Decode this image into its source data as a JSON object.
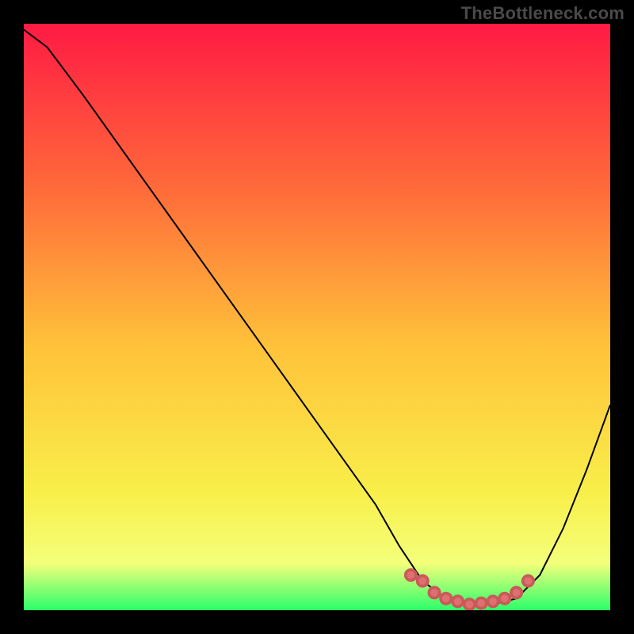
{
  "attribution": "TheBottleneck.com",
  "colors": {
    "gradient_top": "#ff1a44",
    "gradient_upper_mid": "#ff6a3a",
    "gradient_mid": "#ffc23a",
    "gradient_lower_mid": "#f8ef4a",
    "gradient_lower": "#f4ff7a",
    "gradient_bottom": "#2bff6a",
    "curve": "#000000",
    "dot_fill": "#e07070",
    "dot_stroke": "#c85a5a",
    "frame": "#000000"
  },
  "chart_data": {
    "type": "line",
    "title": "",
    "xlabel": "",
    "ylabel": "",
    "xlim": [
      0,
      100
    ],
    "ylim": [
      0,
      100
    ],
    "categories": [
      0,
      4,
      10,
      20,
      30,
      40,
      50,
      60,
      64,
      68,
      72,
      76,
      80,
      84,
      88,
      92,
      96,
      100
    ],
    "series": [
      {
        "name": "curve",
        "x": [
          0,
          4,
          10,
          20,
          30,
          40,
          50,
          60,
          64,
          68,
          72,
          76,
          80,
          84,
          88,
          92,
          96,
          100
        ],
        "values": [
          99,
          96,
          88,
          74,
          60,
          46,
          32,
          18,
          11,
          5,
          2,
          1,
          1,
          2,
          6,
          14,
          24,
          35
        ]
      }
    ],
    "highlight_points": {
      "name": "minimum-region",
      "x": [
        66,
        68,
        70,
        72,
        74,
        76,
        78,
        80,
        82,
        84,
        86
      ],
      "y": [
        6,
        5,
        3,
        2,
        1.5,
        1,
        1.2,
        1.5,
        2,
        3,
        5
      ]
    }
  }
}
